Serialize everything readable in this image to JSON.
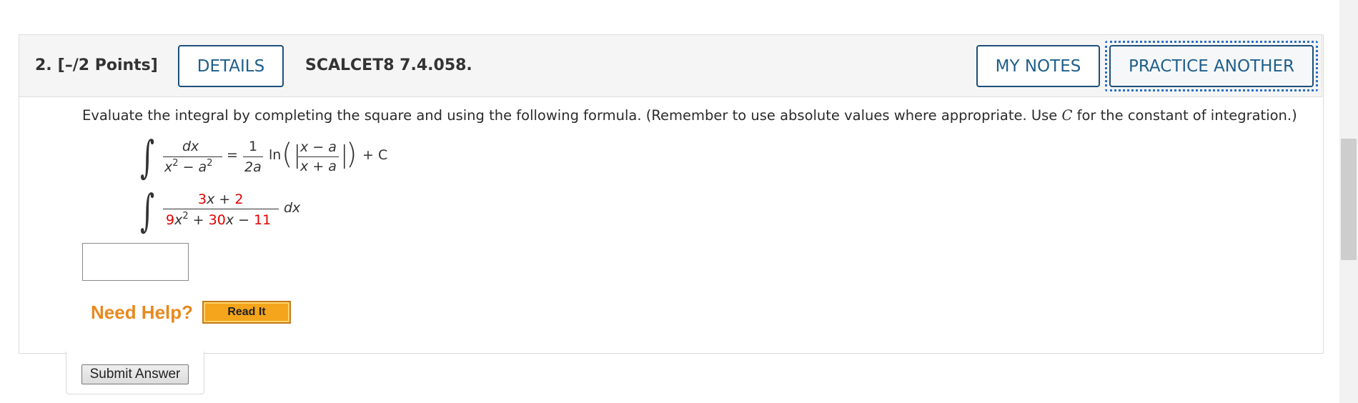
{
  "question": {
    "number": "2.",
    "points": "[–/2 Points]",
    "details_label": "DETAILS",
    "source": "SCALCET8 7.4.058.",
    "my_notes_label": "MY NOTES",
    "practice_label": "PRACTICE ANOTHER"
  },
  "instructions": {
    "before_c": "Evaluate the integral by completing the square and using the following formula. (Remember to use absolute values where appropriate. Use ",
    "c_var": "C",
    "after_c": " for the constant of integration.)"
  },
  "formula": {
    "numerator": "dx",
    "denominator_x": "x",
    "denominator_exp1": "2",
    "denominator_minus": " − ",
    "denominator_a": "a",
    "denominator_exp2": "2",
    "equals": "=",
    "coef_num": "1",
    "coef_den": "2a",
    "ln": "ln",
    "inner_num": "x − a",
    "inner_den": "x + a",
    "plus_c": "+ C"
  },
  "problem": {
    "numerator_coef": "3",
    "numerator_var": "x",
    "numerator_plus": " + ",
    "numerator_const": "2",
    "denominator_coef": "9",
    "denominator_var": "x",
    "denominator_exp": "2",
    "denominator_plus": " + ",
    "denominator_mid_coef": "30",
    "denominator_mid_var": "x",
    "denominator_minus": " − ",
    "denominator_const": "11",
    "differential": "dx"
  },
  "answer": {
    "value": ""
  },
  "help": {
    "label": "Need Help?",
    "read_it": "Read It"
  },
  "submit": {
    "label": "Submit Answer"
  },
  "colors": {
    "accent": "#1f5f8b",
    "help": "#e8891e",
    "coefficient": "#e00000",
    "focus_ring": "#2a6fc9"
  }
}
